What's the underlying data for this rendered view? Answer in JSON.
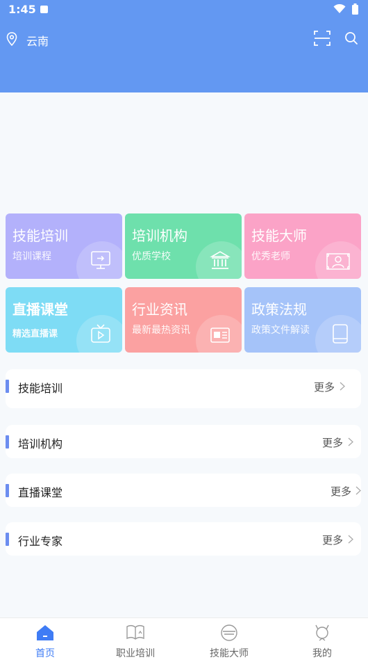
{
  "status": {
    "time": "1:45"
  },
  "header": {
    "location": "云南"
  },
  "grid": [
    {
      "title": "技能培训",
      "subtitle": "培训课程",
      "color": "#b3b1fb",
      "icon": "monitor-icon"
    },
    {
      "title": "培训机构",
      "subtitle": "优质学校",
      "color": "#6ee0ac",
      "icon": "bank-icon"
    },
    {
      "title": "技能大师",
      "subtitle": "优秀老师",
      "color": "#fba3c7",
      "icon": "portrait-icon"
    },
    {
      "title": "直播课堂",
      "subtitle": "精选直播课",
      "color": "#7edcf5",
      "icon": "tv-icon"
    },
    {
      "title": "行业资讯",
      "subtitle": "最新最热资讯",
      "color": "#fba1a1",
      "icon": "newspaper-icon"
    },
    {
      "title": "政策法规",
      "subtitle": "政策文件解读",
      "color": "#a5c3f9",
      "icon": "book-icon"
    }
  ],
  "sections": [
    {
      "title": "技能培训",
      "more": "更多"
    },
    {
      "title": "培训机构",
      "more": "更多"
    },
    {
      "title": "直播课堂",
      "more": "更多"
    },
    {
      "title": "行业专家",
      "more": "更多"
    }
  ],
  "nav": [
    {
      "label": "首页",
      "icon": "home-icon",
      "active": true
    },
    {
      "label": "职业培训",
      "icon": "open-book-icon",
      "active": false
    },
    {
      "label": "技能大师",
      "icon": "mask-icon",
      "active": false
    },
    {
      "label": "我的",
      "icon": "cat-face-icon",
      "active": false
    }
  ],
  "colors": {
    "accent": "#6398f2",
    "active_nav": "#3f7cf5",
    "section_bar": "#6c8df0"
  }
}
